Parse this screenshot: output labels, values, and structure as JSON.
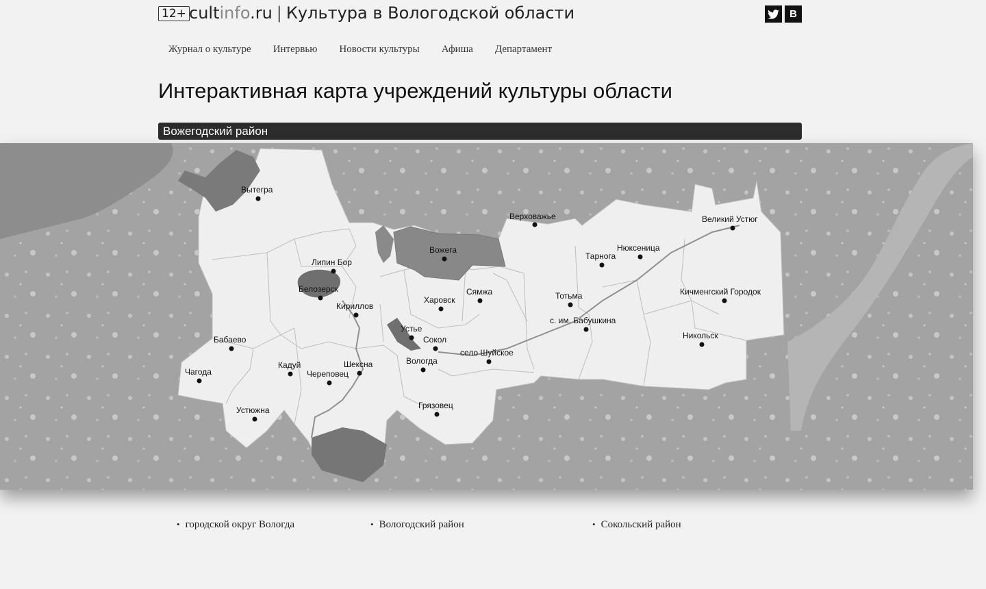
{
  "header": {
    "age_badge": "12+",
    "logo_main": "cult",
    "logo_light": "info",
    "logo_tld": ".ru",
    "separator": "|",
    "site_title": "Культура в Вологодской области",
    "social": [
      {
        "icon": "twitter-icon",
        "glyph": "t"
      },
      {
        "icon": "vk-icon",
        "glyph": "B"
      }
    ]
  },
  "nav": {
    "items": [
      "Журнал о культуре",
      "Интервью",
      "Новости культуры",
      "Афиша",
      "Департамент"
    ]
  },
  "page": {
    "title": "Интерактивная карта учреждений культуры области",
    "selected_district": "Вожегодский район"
  },
  "map": {
    "cities": [
      "Вытегра",
      "Верховажье",
      "Великий Устюг",
      "Вожега",
      "Липин Бор",
      "Нюксеница",
      "Тарнога",
      "Белозерск",
      "Харовск",
      "Сямжа",
      "Тотьма",
      "Кичменгский Городок",
      "Кириллов",
      "с. им. Бабушкина",
      "Устье",
      "Сокол",
      "Бабаево",
      "Никольск",
      "Вологда",
      "село Шуйское",
      "Шексна",
      "Кадуй",
      "Череповец",
      "Чагода",
      "Грязовец",
      "Устюжна"
    ]
  },
  "districts_list": {
    "items": [
      "городской округ Вологда",
      "Вологодский район",
      "Сокольский район"
    ]
  }
}
